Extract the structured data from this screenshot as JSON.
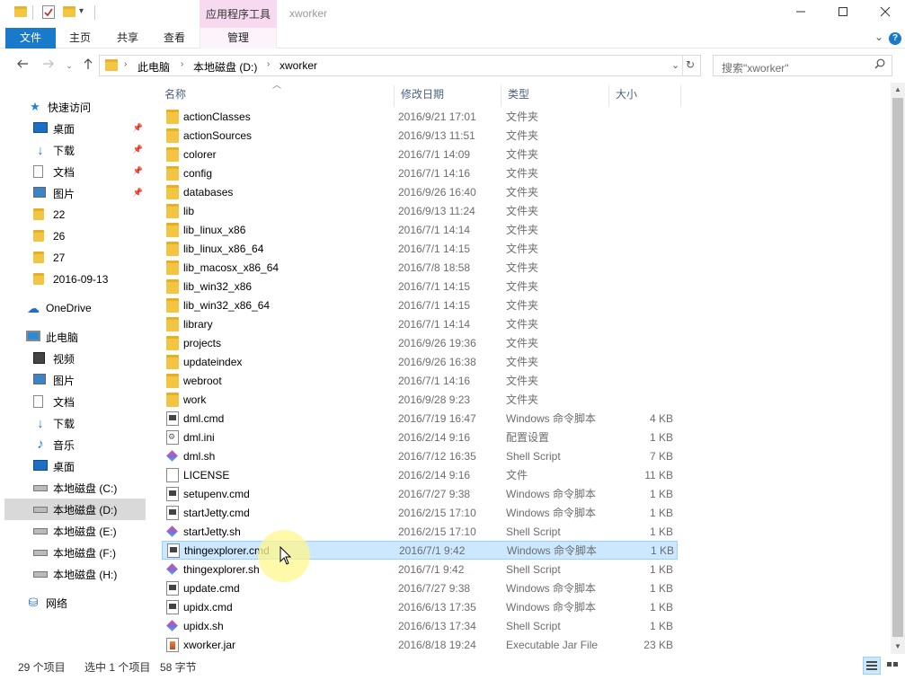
{
  "window": {
    "title": "xworker",
    "context_tab_group": "应用程序工具"
  },
  "ribbon": {
    "tabs": [
      {
        "label": "文件"
      },
      {
        "label": "主页"
      },
      {
        "label": "共享"
      },
      {
        "label": "查看"
      },
      {
        "label": "管理"
      }
    ],
    "help": "?"
  },
  "address": {
    "crumbs": [
      "此电脑",
      "本地磁盘 (D:)",
      "xworker"
    ]
  },
  "search": {
    "placeholder": "搜索\"xworker\""
  },
  "sidebar": {
    "items": [
      {
        "label": "快速访问",
        "icon": "star-icon",
        "pinned": false,
        "selected": false
      },
      {
        "label": "桌面",
        "icon": "desktop-icon",
        "pinned": true,
        "selected": false
      },
      {
        "label": "下载",
        "icon": "download-icon",
        "pinned": true,
        "selected": false
      },
      {
        "label": "文档",
        "icon": "document-icon",
        "pinned": true,
        "selected": false
      },
      {
        "label": "图片",
        "icon": "pictures-icon",
        "pinned": true,
        "selected": false
      },
      {
        "label": "22",
        "icon": "folder-icon",
        "pinned": false,
        "selected": false
      },
      {
        "label": "26",
        "icon": "folder-icon",
        "pinned": false,
        "selected": false
      },
      {
        "label": "27",
        "icon": "folder-icon",
        "pinned": false,
        "selected": false
      },
      {
        "label": "2016-09-13",
        "icon": "folder-icon",
        "pinned": false,
        "selected": false
      },
      {
        "label": "OneDrive",
        "icon": "cloud-icon",
        "pinned": false,
        "selected": false
      },
      {
        "label": "此电脑",
        "icon": "computer-icon",
        "pinned": false,
        "selected": false
      },
      {
        "label": "视频",
        "icon": "video-icon",
        "pinned": false,
        "selected": false
      },
      {
        "label": "图片",
        "icon": "pictures-icon",
        "pinned": false,
        "selected": false
      },
      {
        "label": "文档",
        "icon": "document-icon",
        "pinned": false,
        "selected": false
      },
      {
        "label": "下载",
        "icon": "download-icon",
        "pinned": false,
        "selected": false
      },
      {
        "label": "音乐",
        "icon": "music-icon",
        "pinned": false,
        "selected": false
      },
      {
        "label": "桌面",
        "icon": "desktop-icon",
        "pinned": false,
        "selected": false
      },
      {
        "label": "本地磁盘 (C:)",
        "icon": "drive-icon",
        "pinned": false,
        "selected": false
      },
      {
        "label": "本地磁盘 (D:)",
        "icon": "drive-icon",
        "pinned": false,
        "selected": true
      },
      {
        "label": "本地磁盘 (E:)",
        "icon": "drive-icon",
        "pinned": false,
        "selected": false
      },
      {
        "label": "本地磁盘 (F:)",
        "icon": "drive-icon",
        "pinned": false,
        "selected": false
      },
      {
        "label": "本地磁盘 (H:)",
        "icon": "drive-icon",
        "pinned": false,
        "selected": false
      },
      {
        "label": "网络",
        "icon": "network-icon",
        "pinned": false,
        "selected": false
      }
    ]
  },
  "columns": {
    "name": "名称",
    "date": "修改日期",
    "type": "类型",
    "size": "大小"
  },
  "files": [
    {
      "name": "actionClasses",
      "date": "2016/9/21 17:01",
      "type": "文件夹",
      "size": "",
      "icon": "folder-icon"
    },
    {
      "name": "actionSources",
      "date": "2016/9/13 11:51",
      "type": "文件夹",
      "size": "",
      "icon": "folder-icon"
    },
    {
      "name": "colorer",
      "date": "2016/7/1 14:09",
      "type": "文件夹",
      "size": "",
      "icon": "folder-icon"
    },
    {
      "name": "config",
      "date": "2016/7/1 14:16",
      "type": "文件夹",
      "size": "",
      "icon": "folder-icon"
    },
    {
      "name": "databases",
      "date": "2016/9/26 16:40",
      "type": "文件夹",
      "size": "",
      "icon": "folder-icon"
    },
    {
      "name": "lib",
      "date": "2016/9/13 11:24",
      "type": "文件夹",
      "size": "",
      "icon": "folder-icon"
    },
    {
      "name": "lib_linux_x86",
      "date": "2016/7/1 14:14",
      "type": "文件夹",
      "size": "",
      "icon": "folder-icon"
    },
    {
      "name": "lib_linux_x86_64",
      "date": "2016/7/1 14:15",
      "type": "文件夹",
      "size": "",
      "icon": "folder-icon"
    },
    {
      "name": "lib_macosx_x86_64",
      "date": "2016/7/8 18:58",
      "type": "文件夹",
      "size": "",
      "icon": "folder-icon"
    },
    {
      "name": "lib_win32_x86",
      "date": "2016/7/1 14:15",
      "type": "文件夹",
      "size": "",
      "icon": "folder-icon"
    },
    {
      "name": "lib_win32_x86_64",
      "date": "2016/7/1 14:15",
      "type": "文件夹",
      "size": "",
      "icon": "folder-icon"
    },
    {
      "name": "library",
      "date": "2016/7/1 14:14",
      "type": "文件夹",
      "size": "",
      "icon": "folder-icon"
    },
    {
      "name": "projects",
      "date": "2016/9/26 19:36",
      "type": "文件夹",
      "size": "",
      "icon": "folder-icon"
    },
    {
      "name": "updateindex",
      "date": "2016/9/26 16:38",
      "type": "文件夹",
      "size": "",
      "icon": "folder-icon"
    },
    {
      "name": "webroot",
      "date": "2016/7/1 14:16",
      "type": "文件夹",
      "size": "",
      "icon": "folder-icon"
    },
    {
      "name": "work",
      "date": "2016/9/28 9:23",
      "type": "文件夹",
      "size": "",
      "icon": "folder-icon"
    },
    {
      "name": "dml.cmd",
      "date": "2016/7/19 16:47",
      "type": "Windows 命令脚本",
      "size": "4 KB",
      "icon": "cmd-file-icon"
    },
    {
      "name": "dml.ini",
      "date": "2016/2/14 9:16",
      "type": "配置设置",
      "size": "1 KB",
      "icon": "ini-file-icon"
    },
    {
      "name": "dml.sh",
      "date": "2016/7/12 16:35",
      "type": "Shell Script",
      "size": "7 KB",
      "icon": "shell-script-icon"
    },
    {
      "name": "LICENSE",
      "date": "2016/2/14 9:16",
      "type": "文件",
      "size": "11 KB",
      "icon": "blank-file-icon"
    },
    {
      "name": "setupenv.cmd",
      "date": "2016/7/27 9:38",
      "type": "Windows 命令脚本",
      "size": "1 KB",
      "icon": "cmd-file-icon"
    },
    {
      "name": "startJetty.cmd",
      "date": "2016/2/15 17:10",
      "type": "Windows 命令脚本",
      "size": "1 KB",
      "icon": "cmd-file-icon"
    },
    {
      "name": "startJetty.sh",
      "date": "2016/2/15 17:10",
      "type": "Shell Script",
      "size": "1 KB",
      "icon": "shell-script-icon"
    },
    {
      "name": "thingexplorer.cmd",
      "date": "2016/7/1 9:42",
      "type": "Windows 命令脚本",
      "size": "1 KB",
      "icon": "cmd-file-icon",
      "highlighted": true
    },
    {
      "name": "thingexplorer.sh",
      "date": "2016/7/1 9:42",
      "type": "Shell Script",
      "size": "1 KB",
      "icon": "shell-script-icon"
    },
    {
      "name": "update.cmd",
      "date": "2016/7/27 9:38",
      "type": "Windows 命令脚本",
      "size": "1 KB",
      "icon": "cmd-file-icon"
    },
    {
      "name": "upidx.cmd",
      "date": "2016/6/13 17:35",
      "type": "Windows 命令脚本",
      "size": "1 KB",
      "icon": "cmd-file-icon"
    },
    {
      "name": "upidx.sh",
      "date": "2016/6/13 17:34",
      "type": "Shell Script",
      "size": "1 KB",
      "icon": "shell-script-icon"
    },
    {
      "name": "xworker.jar",
      "date": "2016/8/18 19:24",
      "type": "Executable Jar File",
      "size": "23 KB",
      "icon": "jar-file-icon"
    }
  ],
  "status": {
    "item_count": "29 个项目",
    "selected": "选中 1 个项目",
    "selected_size": "58 字节"
  }
}
